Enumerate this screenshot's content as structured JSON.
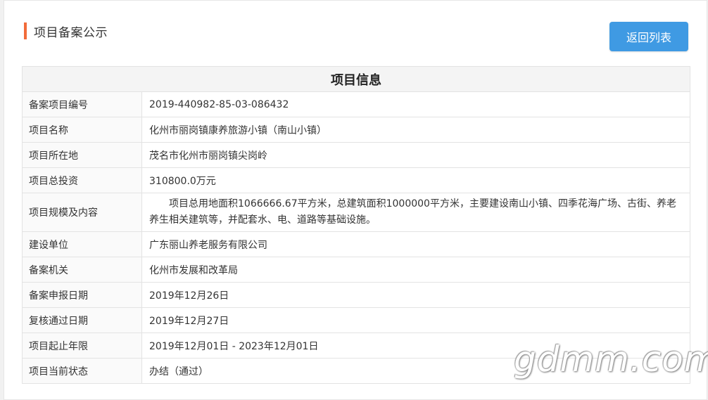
{
  "header": {
    "title": "项目备案公示",
    "back_label": "返回列表"
  },
  "table": {
    "caption": "项目信息",
    "rows": [
      {
        "label": "备案项目编号",
        "value": "2019-440982-85-03-086432"
      },
      {
        "label": "项目名称",
        "value": "化州市丽岗镇康养旅游小镇（南山小镇）"
      },
      {
        "label": "项目所在地",
        "value": "茂名市化州市丽岗镇尖岗岭"
      },
      {
        "label": "项目总投资",
        "value": "310800.0万元"
      },
      {
        "label": "项目规模及内容",
        "value": "项目总用地面积1066666.67平方米，总建筑面积1000000平方米，主要建设南山小镇、四季花海广场、古街、养老养生相关建筑等，并配套水、电、道路等基础设施。"
      },
      {
        "label": "建设单位",
        "value": "广东丽山养老服务有限公司"
      },
      {
        "label": "备案机关",
        "value": "化州市发展和改革局"
      },
      {
        "label": "备案申报日期",
        "value": "2019年12月26日"
      },
      {
        "label": "复核通过日期",
        "value": "2019年12月27日"
      },
      {
        "label": "项目起止年限",
        "value": "2019年12月01日 - 2023年12月01日"
      },
      {
        "label": "项目当前状态",
        "value": "办结（通过）"
      }
    ]
  },
  "watermark": "gdmm.com",
  "colors": {
    "accent_bar": "#f26b3a",
    "button_bg": "#3f9ae3"
  }
}
